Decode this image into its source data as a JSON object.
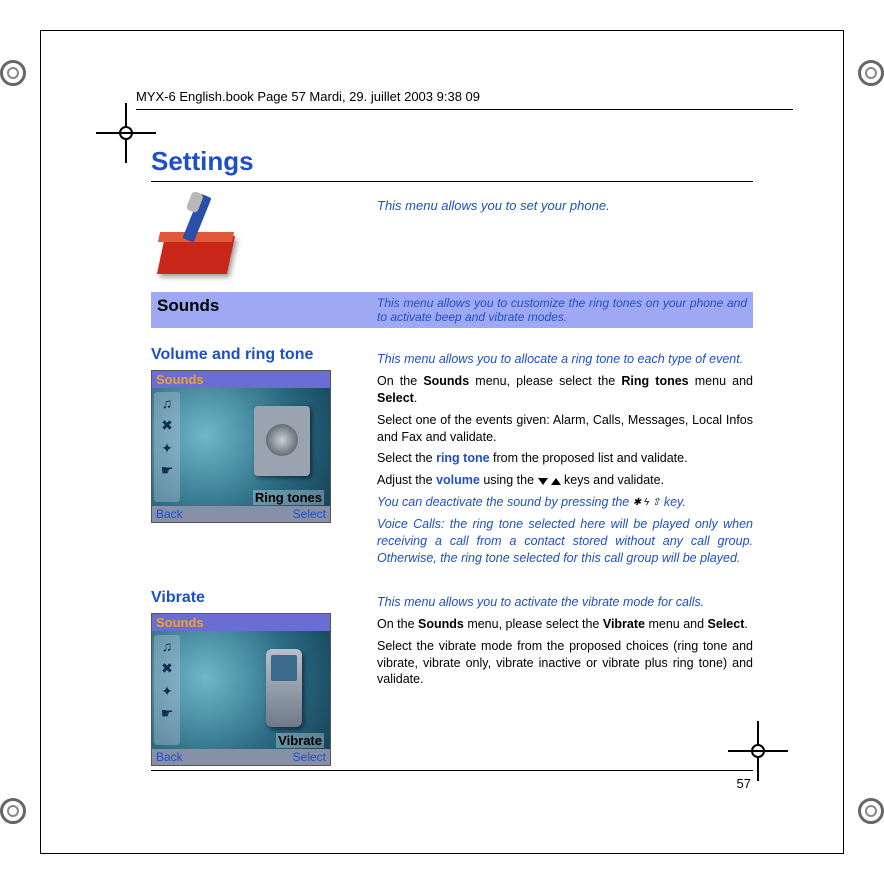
{
  "header": "MYX-6 English.book  Page 57  Mardi, 29. juillet 2003  9:38 09",
  "title": "Settings",
  "intro": "This menu allows you to set your phone.",
  "sounds_band": {
    "left": "Sounds",
    "right": "This menu allows you to customize the ring tones on your phone and to activate beep and vibrate modes."
  },
  "volume": {
    "heading": "Volume and ring tone",
    "desc": "This menu allows you to allocate a ring tone to each type of event.",
    "p1a": "On the ",
    "p1b": "Sounds",
    "p1c": " menu, please select the ",
    "p1d": "Ring tones",
    "p1e": " menu and ",
    "p1f": "Select",
    "p1g": ".",
    "p2": "Select one of the events given: Alarm, Calls, Messages, Local Infos and Fax and validate.",
    "p3a": "Select the ",
    "p3b": "ring tone",
    "p3c": " from the proposed list and validate.",
    "p4a": "Adjust the ",
    "p4b": "volume",
    "p4c": " using the ",
    "p4d": " keys and validate.",
    "p5a": "You can deactivate the sound by pressing the ",
    "p5b": " key.",
    "p6": "Voice Calls: the ring tone selected here will be played only when receiving a call from a contact stored without any call group. Otherwise, the ring tone selected for this call group will be played."
  },
  "vibrate": {
    "heading": "Vibrate",
    "desc": "This menu allows you to activate the vibrate mode for calls.",
    "p1a": "On the ",
    "p1b": "Sounds",
    "p1c": " menu, please select the ",
    "p1d": "Vibrate",
    "p1e": " menu and ",
    "p1f": "Select",
    "p1g": ".",
    "p2": "Select the vibrate mode from the proposed choices (ring tone and vibrate, vibrate only, vibrate inactive or vibrate plus ring tone) and validate."
  },
  "screen1": {
    "title": "Sounds",
    "label": "Ring tones",
    "back": "Back",
    "select": "Select"
  },
  "screen2": {
    "title": "Sounds",
    "label": "Vibrate",
    "back": "Back",
    "select": "Select"
  },
  "page_num": "57"
}
